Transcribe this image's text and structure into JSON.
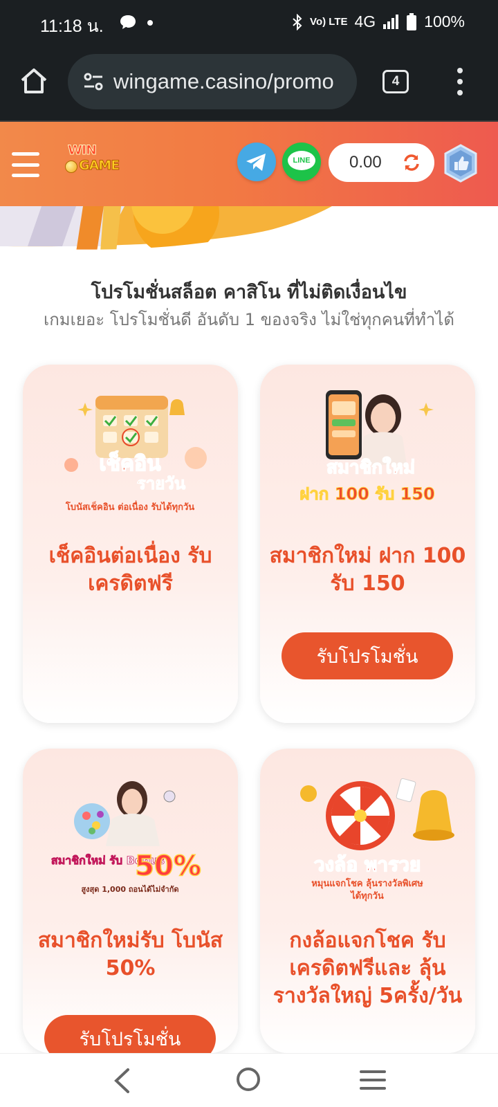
{
  "status_bar": {
    "time": "11:18 น.",
    "network_small": "Vo) LTE",
    "network": "4G",
    "battery": "100%"
  },
  "browser": {
    "url": "wingame.casino/promo",
    "tab_count": "4"
  },
  "header": {
    "logo_line1": "WIN",
    "logo_line2": "GAME",
    "line_label": "LINE",
    "balance": "0.00"
  },
  "page": {
    "headline": "โปรโมชั่นสล็อต คาสิโน ที่ไม่ติดเงื่อนไข",
    "subline": "เกมเยอะ โปรโมชั่นดี อันดับ 1 ของจริง ไม่ใช่ทุกคนที่ทำได้"
  },
  "promos": [
    {
      "title": "เช็คอินต่อเนื่อง รับเครดิตฟรี",
      "art_line1": "เช็คอิน",
      "art_line2": "รายวัน",
      "art_line3": "โบนัสเช็คอิน ต่อเนื่อง รับได้ทุกวัน",
      "button": ""
    },
    {
      "title": "สมาชิกใหม่ ฝาก 100 รับ 150",
      "art_line1": "สมาชิกใหม่",
      "art_line2": "ฝาก 100 รับ 150",
      "button": "รับโปรโมชั่น"
    },
    {
      "title": "สมาชิกใหม่รับ โบนัส 50%",
      "art_line1": "สมาชิกใหม่ รับ Bonus",
      "art_line2": "50%",
      "art_line3": "สูงสุด 1,000 ถอนได้ไม่จำกัด",
      "button": "รับโปรโมชั่น"
    },
    {
      "title": "กงล้อแจกโชค รับเครดิตฟรีและ ลุ้นรางวัลใหญ่ 5ครั้ง/วัน",
      "art_line1": "วงล้อ พารวย",
      "art_line2": "หมุนแจกโชค ลุ้นรางวัลพิเศษ",
      "art_line3": "ได้ทุกวัน",
      "button": ""
    }
  ],
  "colors": {
    "header_start": "#f2894a",
    "header_end": "#ee5a4f",
    "accent": "#e8552d",
    "card_bg": "#fde7e1",
    "status_bg": "#1b1f22"
  }
}
